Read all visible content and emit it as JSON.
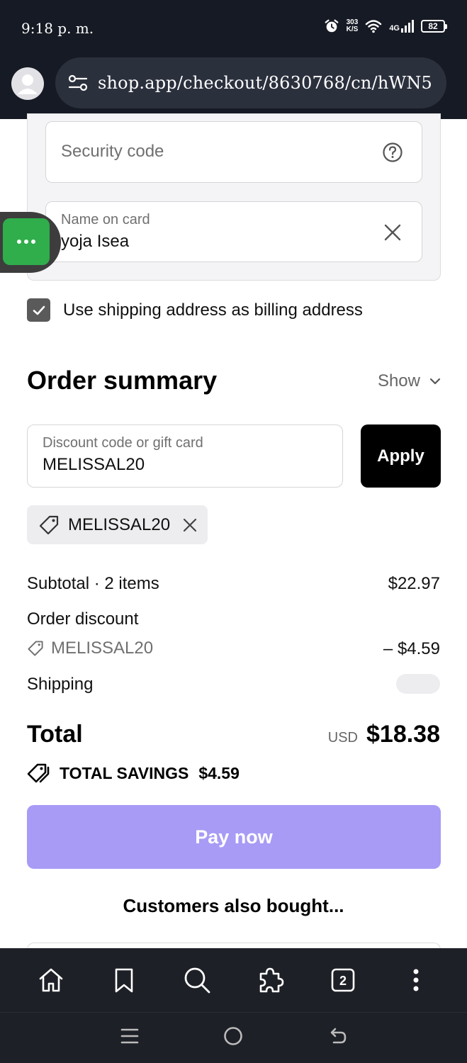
{
  "status_bar": {
    "time": "9:18 p. m.",
    "net_speed_value": "303",
    "net_speed_unit": "K/S",
    "network": "4G",
    "battery": "82"
  },
  "browser": {
    "url": "shop.app/checkout/8630768/cn/hWN5"
  },
  "payment": {
    "security_placeholder": "Security code",
    "name_label": "Name on card",
    "name_value": "yoja Isea"
  },
  "billing": {
    "checked": true,
    "label": "Use shipping address as billing address"
  },
  "order_summary": {
    "title": "Order summary",
    "toggle_label": "Show",
    "discount_label": "Discount code or gift card",
    "discount_value": "MELISSAL20",
    "apply_label": "Apply",
    "applied_code": "MELISSAL20",
    "subtotal_label": "Subtotal · 2 items",
    "subtotal_value": "$22.97",
    "discount_row_label": "Order discount",
    "discount_code": "MELISSAL20",
    "discount_amount": "– $4.59",
    "shipping_label": "Shipping",
    "total_label": "Total",
    "currency": "USD",
    "total_value": "$18.38",
    "savings_label": "TOTAL SAVINGS",
    "savings_value": "$4.59",
    "pay_label": "Pay now",
    "also_bought": "Customers also bought..."
  },
  "bottom_nav": {
    "tab_count": "2"
  },
  "colors": {
    "topbar": "#161a24",
    "pay_button": "#a79bf6",
    "apply_button": "#000000",
    "floating_button": "#2fae4b"
  }
}
